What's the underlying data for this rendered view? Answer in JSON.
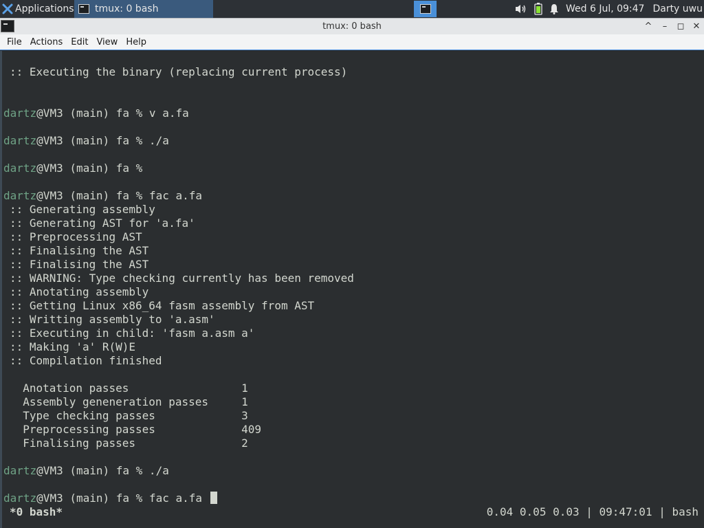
{
  "panel": {
    "applications_label": "Applications",
    "task_label": "tmux: 0 bash",
    "clock": "Wed  6 Jul, 09:47",
    "user": "Darty uwu",
    "tray_icons": [
      "volume-icon",
      "battery-icon",
      "notification-bell-icon"
    ]
  },
  "window": {
    "title": "tmux: 0 bash",
    "controls": [
      "^",
      "–",
      "◻",
      "✕"
    ]
  },
  "menubar": {
    "items": [
      "File",
      "Actions",
      "Edit",
      "View",
      "Help"
    ]
  },
  "terminal": {
    "prompt_user": "dartz",
    "prompt_rest": "@VM3 (main) fa %",
    "lines": [
      {
        "kind": "text",
        "text": ":: Executing the binary (replacing current process)"
      },
      {
        "kind": "blank"
      },
      {
        "kind": "blank"
      },
      {
        "kind": "prompt",
        "cmd": " v a.fa"
      },
      {
        "kind": "blank"
      },
      {
        "kind": "prompt",
        "cmd": " ./a"
      },
      {
        "kind": "blank"
      },
      {
        "kind": "prompt",
        "cmd": ""
      },
      {
        "kind": "blank"
      },
      {
        "kind": "prompt",
        "cmd": " fac a.fa"
      },
      {
        "kind": "text",
        "text": ":: Generating assembly"
      },
      {
        "kind": "text",
        "text": ":: Generating AST for 'a.fa'"
      },
      {
        "kind": "text",
        "text": ":: Preprocessing AST"
      },
      {
        "kind": "text",
        "text": ":: Finalising the AST"
      },
      {
        "kind": "text",
        "text": ":: Finalising the AST"
      },
      {
        "kind": "text",
        "text": ":: WARNING: Type checking currently has been removed"
      },
      {
        "kind": "text",
        "text": ":: Anotating assembly"
      },
      {
        "kind": "text",
        "text": ":: Getting Linux x86_64 fasm assembly from AST"
      },
      {
        "kind": "text",
        "text": ":: Writting assembly to 'a.asm'"
      },
      {
        "kind": "text",
        "text": ":: Executing in child: 'fasm a.asm a'"
      },
      {
        "kind": "text",
        "text": ":: Making 'a' R(W)E"
      },
      {
        "kind": "text",
        "text": ":: Compilation finished"
      },
      {
        "kind": "blank"
      },
      {
        "kind": "text",
        "text": "  Anotation passes                 1"
      },
      {
        "kind": "text",
        "text": "  Assembly geneneration passes     1"
      },
      {
        "kind": "text",
        "text": "  Type checking passes             3"
      },
      {
        "kind": "text",
        "text": "  Preprocessing passes             409"
      },
      {
        "kind": "text",
        "text": "  Finalising passes                2"
      },
      {
        "kind": "blank"
      },
      {
        "kind": "prompt",
        "cmd": " ./a"
      },
      {
        "kind": "blank"
      },
      {
        "kind": "prompt",
        "cmd": " fac a.fa ",
        "cursor": true
      }
    ]
  },
  "tmux": {
    "window_label": "*0 bash*",
    "status_right": "0.04 0.05 0.03 | 09:47:01 | bash"
  }
}
